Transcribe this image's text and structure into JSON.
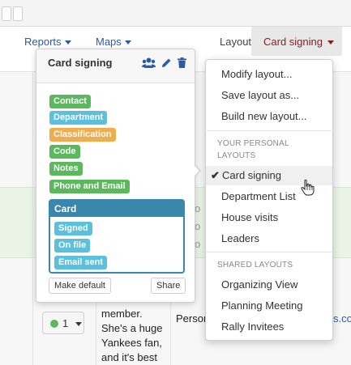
{
  "nav": {
    "reports_label": "Reports",
    "maps_label": "Maps",
    "layout_label": "Layout",
    "layout_selected": "Card signing"
  },
  "background": {
    "row_number": "1",
    "row_text_lines": [
      "member.",
      "She's a huge",
      "Yankees fan,",
      "and it's best"
    ],
    "person_text": "Person",
    "person_suffix": "s.co",
    "faded_letters": [
      "o",
      "o",
      "o"
    ],
    "colors": {
      "highlight_row": "#e9f4e6",
      "status_dot": "#5cb85c"
    }
  },
  "card_popover": {
    "title": "Card signing",
    "icons": [
      "users-icon",
      "pencil-icon",
      "trash-icon"
    ],
    "tags": [
      {
        "label": "Contact",
        "color": "#5cb85c"
      },
      {
        "label": "Department",
        "color": "#5bc0de"
      },
      {
        "label": "Classification",
        "color": "#f0ad4e"
      },
      {
        "label": "Code",
        "color": "#5cb85c"
      },
      {
        "label": "Notes",
        "color": "#5cb85c"
      },
      {
        "label": "Phone and Email",
        "color": "#5cb85c"
      }
    ],
    "group": {
      "title": "Card",
      "color": "#3a87ad",
      "items": [
        "Signed",
        "On file",
        "Email sent"
      ]
    },
    "make_default_label": "Make default",
    "share_label": "Share"
  },
  "layout_menu": {
    "actions": [
      "Modify layout...",
      "Save layout as...",
      "Build new layout..."
    ],
    "personal_header": "YOUR PERSONAL LAYOUTS",
    "personal": [
      "Card signing",
      "Department List",
      "House visits",
      "Leaders"
    ],
    "active_item": "Card signing",
    "shared_header": "SHARED LAYOUTS",
    "shared": [
      "Organizing View",
      "Planning Meeting",
      "Rally Invitees"
    ]
  }
}
